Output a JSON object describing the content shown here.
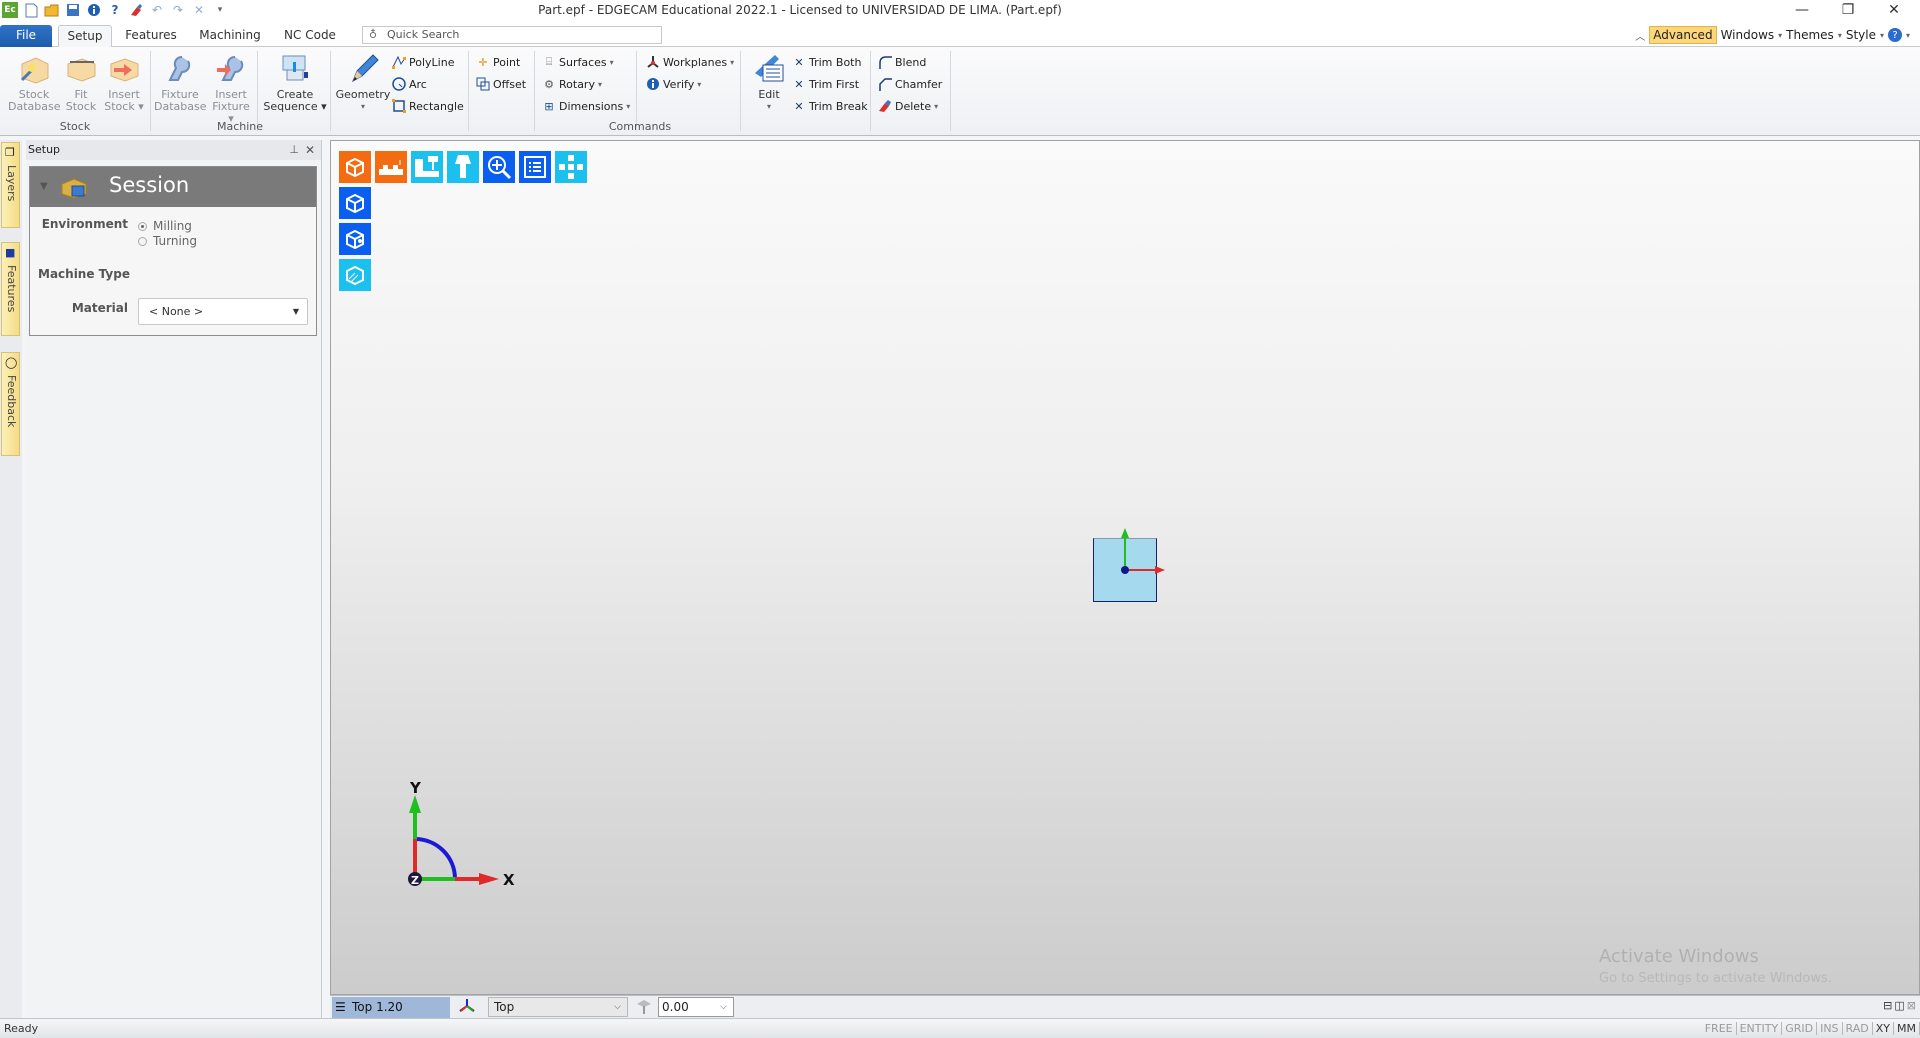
{
  "window": {
    "title": "Part.epf - EDGECAM Educational 2022.1  - Licensed to UNIVERSIDAD DE LIMA. (Part.epf)",
    "app_logo": "Ec",
    "minimize": "—",
    "restore": "❐",
    "close": "✕"
  },
  "quick_access": [
    "new-file-icon",
    "open-folder-icon",
    "save-icon",
    "info-icon",
    "measure-help-icon",
    "eraser-icon",
    "undo-icon",
    "redo-icon",
    "cancel-icon",
    "customize-icon"
  ],
  "tabs": [
    {
      "label": "File"
    },
    {
      "label": "Setup",
      "active": true
    },
    {
      "label": "Features"
    },
    {
      "label": "Machining"
    },
    {
      "label": "NC Code"
    }
  ],
  "quick_search": {
    "placeholder": "Quick Search"
  },
  "right_menu": {
    "advanced": "Advanced",
    "windows": "Windows",
    "themes": "Themes",
    "style": "Style",
    "help": "?"
  },
  "ribbon": {
    "stock": {
      "label": "Stock",
      "buttons": [
        {
          "line1": "Stock",
          "line2": "Database"
        },
        {
          "line1": "Fit",
          "line2": "Stock"
        },
        {
          "line1": "Insert",
          "line2": "Stock ▾"
        }
      ]
    },
    "machine": {
      "label": "Machine",
      "buttons": [
        {
          "line1": "Fixture",
          "line2": "Database"
        },
        {
          "line1": "Insert",
          "line2": "Fixture ▾"
        },
        {
          "line1": "Create",
          "line2": "Sequence ▾"
        }
      ]
    },
    "commands": {
      "label": "Commands",
      "geometry": {
        "line1": "Geometry",
        "line2": "▾"
      },
      "polyline": "PolyLine",
      "arc": "Arc",
      "rectangle": "Rectangle",
      "point": "Point",
      "offset": "Offset",
      "surfaces": "Surfaces",
      "rotary": "Rotary",
      "dimensions": "Dimensions",
      "workplanes": "Workplanes",
      "verify": "Verify",
      "edit": {
        "line1": "Edit",
        "line2": "▾"
      },
      "trim_both": "Trim Both",
      "trim_first": "Trim First",
      "trim_break": "Trim Break",
      "blend": "Blend",
      "chamfer": "Chamfer",
      "delete": "Delete"
    }
  },
  "side_tabs": [
    "Layers",
    "Features",
    "Feedback"
  ],
  "panel": {
    "title": "Setup",
    "pin": "⊥",
    "close": "✕",
    "session": {
      "title": "Session",
      "environment_label": "Environment",
      "environment_options": [
        {
          "label": "Milling",
          "selected": true
        },
        {
          "label": "Turning",
          "selected": false
        }
      ],
      "machine_type_label": "Machine Type",
      "material_label": "Material",
      "material_value": "< None >"
    }
  },
  "viewport": {
    "tools_row": [
      {
        "name": "stock-cube-icon",
        "color": "#f36c12"
      },
      {
        "name": "fixture-icon",
        "color": "#f36c12"
      },
      {
        "name": "machine-icon",
        "color": "#1cc0ef"
      },
      {
        "name": "tool-holder-icon",
        "color": "#1cc0ef"
      },
      {
        "name": "zoom-pan-icon",
        "color": "#0a5ff0"
      },
      {
        "name": "list-icon",
        "color": "#0a5ff0"
      },
      {
        "name": "layout-icon",
        "color": "#1cc0ef"
      }
    ],
    "tools_column": [
      {
        "name": "view-box-icon",
        "color": "#0a5ff0"
      },
      {
        "name": "view-solid-icon",
        "color": "#0a5ff0"
      },
      {
        "name": "view-hatch-icon",
        "color": "#1cc0ef"
      }
    ],
    "axis_labels": {
      "x": "X",
      "y": "Y",
      "z": "Z"
    },
    "watermark": {
      "title": "Activate Windows",
      "subtitle": "Go to Settings to activate Windows."
    }
  },
  "viewbar": {
    "scale": "Top 1.20",
    "view": "Top",
    "depth": "0.00"
  },
  "status": {
    "text": "Ready",
    "flags": [
      {
        "label": "FREE",
        "on": false
      },
      {
        "label": "ENTITY",
        "on": false
      },
      {
        "label": "GRID",
        "on": false
      },
      {
        "label": "INS",
        "on": false
      },
      {
        "label": "RAD",
        "on": false
      },
      {
        "label": "XY",
        "on": true
      },
      {
        "label": "MM",
        "on": true
      }
    ]
  }
}
